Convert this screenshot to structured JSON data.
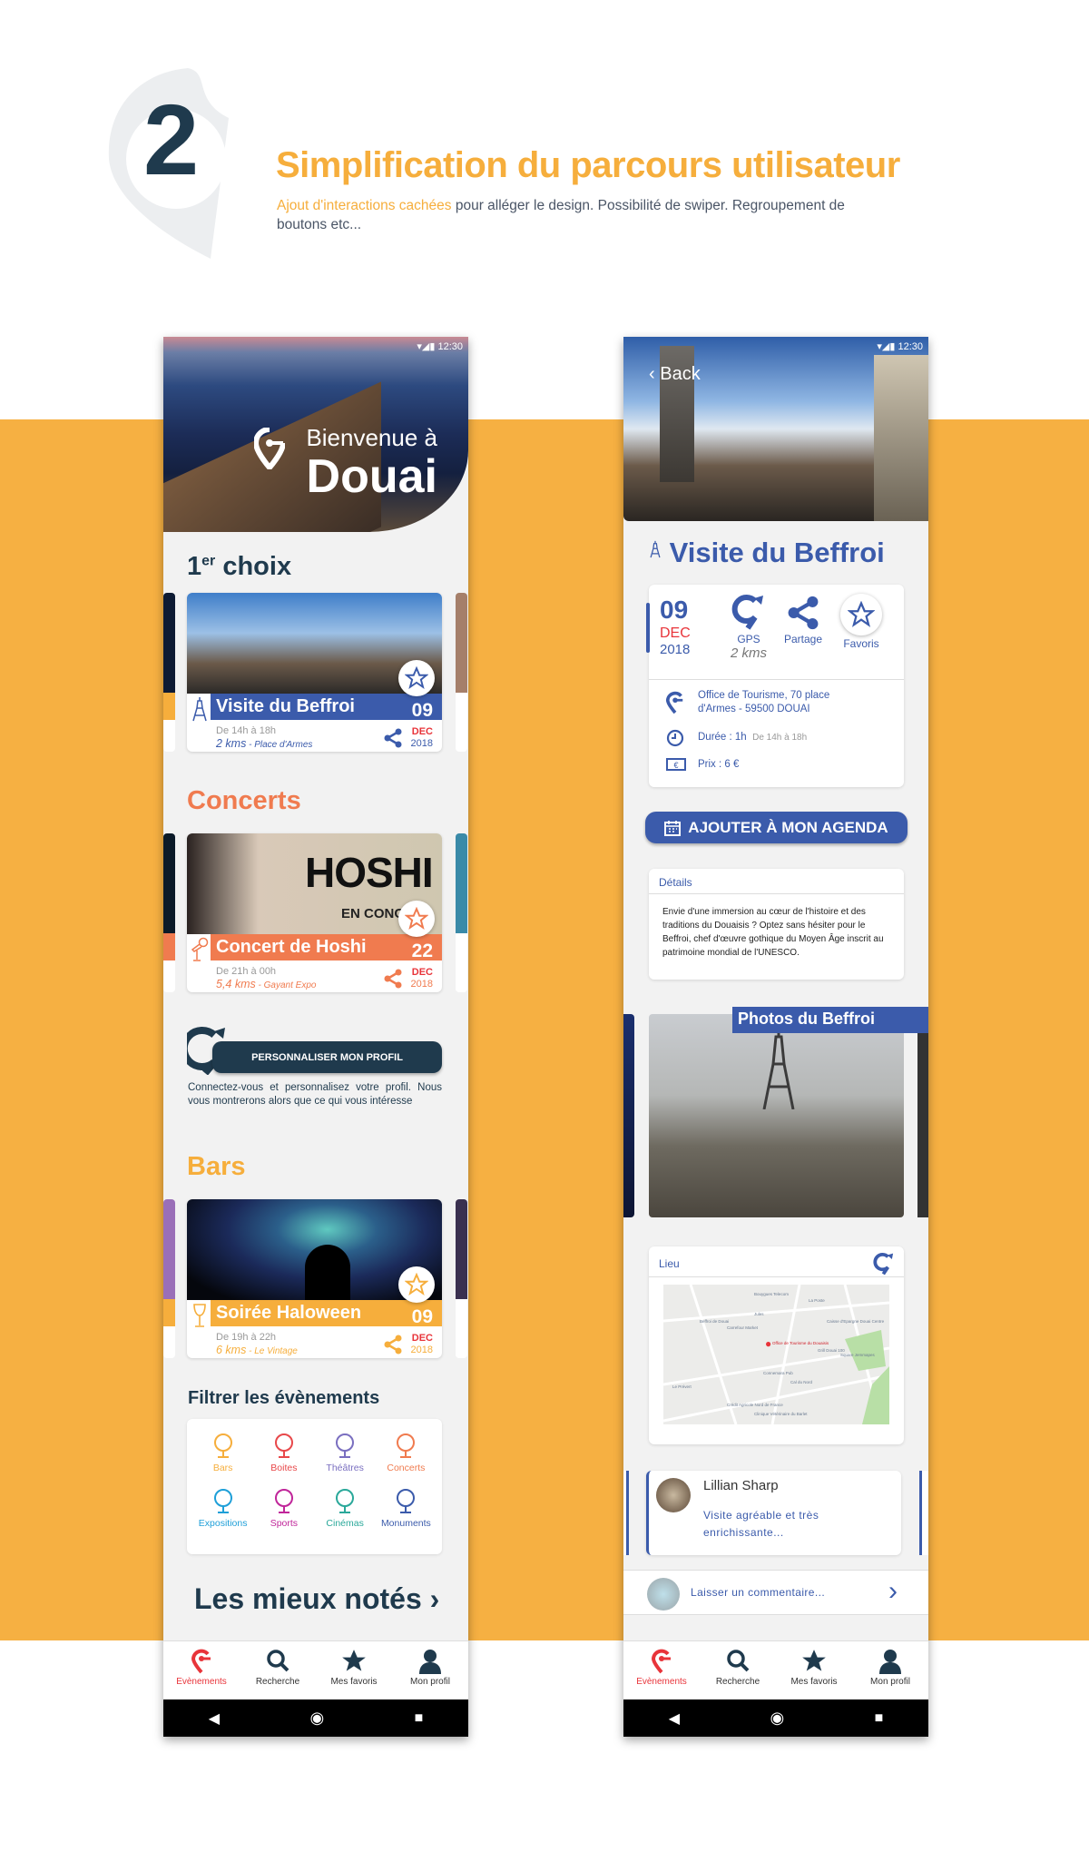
{
  "colors": {
    "accent_orange": "#f6b042",
    "blue": "#3b5bab",
    "concert": "#f07b4f",
    "bars": "#f6ae3c",
    "navy": "#1f3a4d",
    "red": "#e8343a"
  },
  "header": {
    "number": "2",
    "title": "Simplification du parcours utilisateur",
    "subtitle_highlight": "Ajout d'interactions cachées",
    "subtitle_rest": " pour alléger le design. Possibilité de swiper. Regroupement de boutons etc..."
  },
  "status": {
    "time": "12:30"
  },
  "home": {
    "welcome": "Bienvenue à",
    "city": "Douai",
    "first_choice": {
      "num": "1",
      "sup": "er",
      "label": "choix"
    },
    "sections": {
      "concerts": "Concerts",
      "bars": "Bars",
      "filter": "Filtrer les évènements",
      "top_rated": "Les mieux notés"
    },
    "cards": [
      {
        "title": "Visite du Beffroi",
        "day": "09",
        "month": "DEC",
        "year": "2018",
        "time": "De 14h à 18h",
        "distance": "2 kms",
        "place": " - Place d'Armes",
        "icon": "monument-icon",
        "color": "#3b5bab"
      },
      {
        "title": "Concert de Hoshi",
        "day": "22",
        "month": "DEC",
        "year": "2018",
        "time": "De 21h à 00h",
        "distance": "5,4 kms",
        "place": " - Gayant Expo",
        "icon": "microphone-icon",
        "color": "#f07b4f",
        "poster_text": "HOSHI",
        "poster_sub": "EN CONCERT"
      },
      {
        "title": "Soirée Haloween",
        "day": "09",
        "month": "DEC",
        "year": "2018",
        "time": "De 19h à 22h",
        "distance": "6 kms",
        "place": " - Le Vintage",
        "icon": "wine-glass-icon",
        "color": "#f6ae3c"
      }
    ],
    "profile": {
      "button": "PERSONNALISER MON PROFIL",
      "text": "Connectez-vous et personnalisez votre profil. Nous vous montrerons alors que ce qui vous intéresse"
    },
    "filters": [
      {
        "label": "Bars",
        "color": "#f6ae3c",
        "icon": "wine-glass-icon"
      },
      {
        "label": "Boites",
        "color": "#e8484a",
        "icon": "vinyl-disc-icon"
      },
      {
        "label": "Théâtres",
        "color": "#7a6fc0",
        "icon": "theatre-masks-icon"
      },
      {
        "label": "Concerts",
        "color": "#f07b4f",
        "icon": "microphone-icon"
      },
      {
        "label": "Expositions",
        "color": "#1e9fd8",
        "icon": "easel-icon"
      },
      {
        "label": "Sports",
        "color": "#c0269a",
        "icon": "trophy-icon"
      },
      {
        "label": "Cinémas",
        "color": "#2aa89a",
        "icon": "film-camera-icon"
      },
      {
        "label": "Monuments",
        "color": "#3b5bab",
        "icon": "monument-icon"
      }
    ]
  },
  "nav": [
    {
      "label": "Evènements",
      "icon": "location-pin-icon",
      "active": true
    },
    {
      "label": "Recherche",
      "icon": "search-icon"
    },
    {
      "label": "Mes favoris",
      "icon": "star-icon"
    },
    {
      "label": "Mon profil",
      "icon": "user-icon"
    }
  ],
  "detail": {
    "back": "Back",
    "title": "Visite du Beffroi",
    "day": "09",
    "month": "DEC",
    "year": "2018",
    "gps": "GPS",
    "gps_dist": "2 kms",
    "share": "Partage",
    "fav": "Favoris",
    "address": "Office de Tourisme, 70 place d'Armes - 59500 DOUAI",
    "duration": "Durée : 1h",
    "hours": "De 14h à 18h",
    "price": "Prix : 6 €",
    "agenda": "AJOUTER À MON AGENDA",
    "details_label": "Détails",
    "details_text": "Envie d'une immersion au cœur de l'histoire et des traditions du Douaisis ? Optez sans hésiter pour le Beffroi, chef d'œuvre gothique du Moyen Âge inscrit au patrimoine mondial de l'UNESCO.",
    "photos": "Photos du Beffroi",
    "place_label": "Lieu",
    "map_labels": [
      "Bouygues Telecom",
      "La Poste",
      "Jules",
      "Beffroi de Douai",
      "Carrefour Market",
      "Office de Tourisme du Douaisis",
      "Caisse d'Epargne Douai Centre",
      "Grill Douai 100",
      "Square Jemmapes",
      "Le Prévert",
      "Connemara Pub",
      "Cal du Nord",
      "Crédit Agricole Nord de France",
      "Clinique Vétérinaire du Barlet"
    ],
    "review": {
      "name": "Lillian Sharp",
      "text": "Visite agréable et très enrichissante..."
    },
    "comment_placeholder": "Laisser un commentaire..."
  }
}
